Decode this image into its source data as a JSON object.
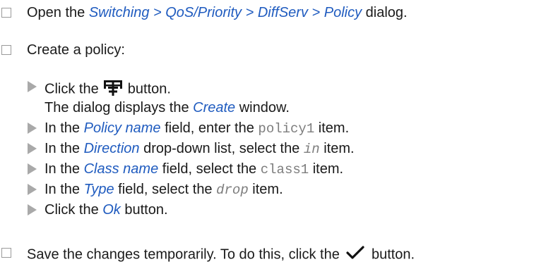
{
  "steps": [
    {
      "pre": "Open the ",
      "link": "Switching > QoS/Priority > DiffServ > Policy",
      "post": " dialog."
    },
    {
      "text": "Create a policy:"
    },
    {
      "pre": "Save the changes temporarily. To do this, click the ",
      "icon": "checkmark-icon",
      "post": " button."
    }
  ],
  "substeps": {
    "click_add": {
      "pre": "Click the ",
      "icon": "add-table-icon",
      "post": " button."
    },
    "result": {
      "pre": "The dialog displays the ",
      "link": "Create",
      "post": " window."
    },
    "policy_name": {
      "pre": "In the ",
      "link": "Policy name",
      "mid": " field, enter the ",
      "value": "policy1",
      "post": " item."
    },
    "direction": {
      "pre": "In the ",
      "link": "Direction",
      "mid": " drop-down list, select the ",
      "value": "in",
      "post": " item."
    },
    "class_name": {
      "pre": "In the ",
      "link": "Class name",
      "mid": " field, select the ",
      "value": "class1",
      "post": " item."
    },
    "type": {
      "pre": "In the ",
      "link": "Type",
      "mid": " field, select the ",
      "value": "drop",
      "post": " item."
    },
    "click_ok": {
      "pre": "Click the ",
      "link": "Ok",
      "post": " button."
    }
  },
  "colors": {
    "link": "#1f5bbf",
    "code": "#7d7d7d",
    "bullet": "#a9a9a9",
    "checkbox": "#9a9a9a"
  }
}
